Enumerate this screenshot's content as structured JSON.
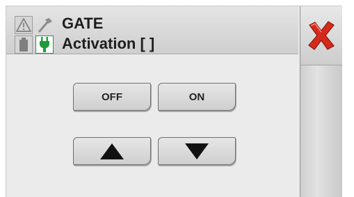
{
  "header": {
    "title": "GATE",
    "subtitle": "Activation [ ]",
    "icons": {
      "warning": "warning-icon",
      "hammer": "hammer-icon",
      "battery": "battery-icon",
      "plug": "plug-icon"
    }
  },
  "controls": {
    "off_label": "OFF",
    "on_label": "ON",
    "up_icon": "arrow-up-icon",
    "down_icon": "arrow-down-icon"
  },
  "close": {
    "icon": "close-icon"
  },
  "colors": {
    "close_red": "#d42a1c",
    "plug_green": "#1f9c3a",
    "background": "#ebebeb"
  }
}
